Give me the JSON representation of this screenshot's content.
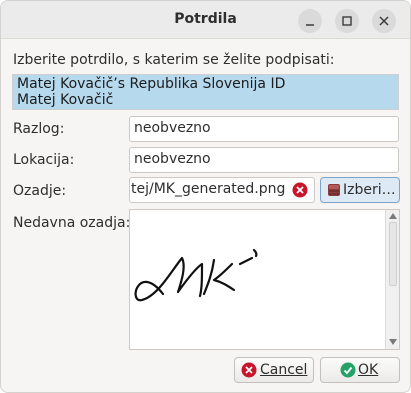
{
  "window": {
    "title": "Potrdila"
  },
  "prompt": "Izberite potrdilo, s katerim se želite podpisati:",
  "certificate": {
    "line1": "Matej Kovačič’s Republika Slovenija ID",
    "line2": "Matej Kovačič"
  },
  "form": {
    "reason_label": "Razlog:",
    "reason_value": "neobvezno",
    "location_label": "Lokacija:",
    "location_value": "neobvezno",
    "background_label": "Ozadje:",
    "background_value": "tej/MK_generated.png",
    "browse_label": "Izberi…",
    "recent_label": "Nedavna ozadja:"
  },
  "buttons": {
    "cancel": "Cancel",
    "ok": "OK"
  },
  "colors": {
    "selection": "#b6d9ee",
    "cancel_icon": "#c7162b",
    "ok_icon": "#26a269"
  }
}
